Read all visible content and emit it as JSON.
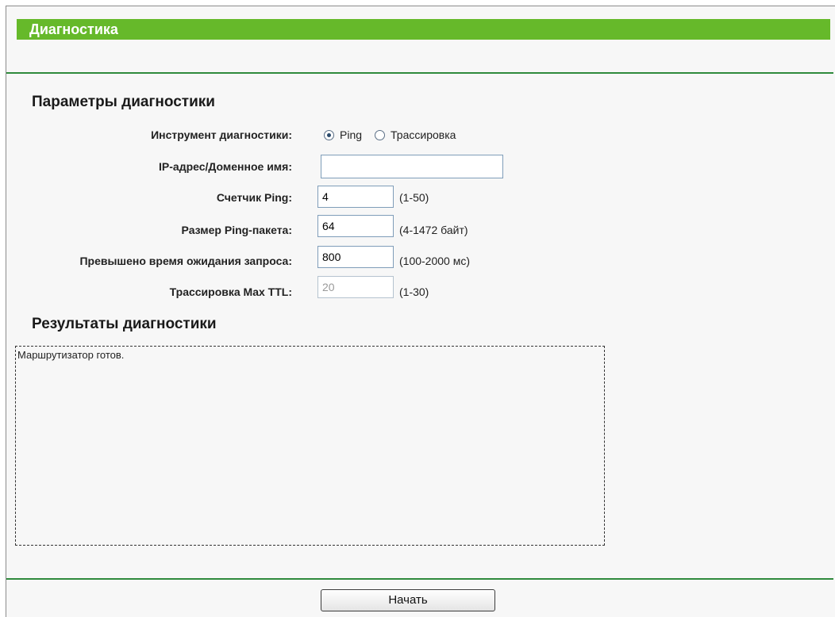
{
  "header": {
    "title": "Диагностика"
  },
  "params": {
    "section_title": "Параметры диагностики",
    "tool": {
      "label": "Инструмент диагностики:",
      "options": [
        {
          "label": "Ping",
          "checked": true
        },
        {
          "label": "Трассировка",
          "checked": false
        }
      ]
    },
    "ip": {
      "label": "IP-адрес/Доменное имя:",
      "value": ""
    },
    "ping_count": {
      "label": "Счетчик Ping:",
      "value": "4",
      "hint": "(1-50)"
    },
    "ping_size": {
      "label": "Размер Ping-пакета:",
      "value": "64",
      "hint": "(4-1472 байт)"
    },
    "timeout": {
      "label": "Превышено время ожидания запроса:",
      "value": "800",
      "hint": "(100-2000 мс)"
    },
    "max_ttl": {
      "label": "Трассировка Max TTL:",
      "value": "20",
      "hint": "(1-30)"
    }
  },
  "results": {
    "section_title": "Результаты диагностики",
    "text": "Маршрутизатор готов."
  },
  "actions": {
    "start_label": "Начать"
  },
  "colors": {
    "title_bar": "#66b92a",
    "divider": "#2f8a3c",
    "background": "#f7f7f7"
  }
}
